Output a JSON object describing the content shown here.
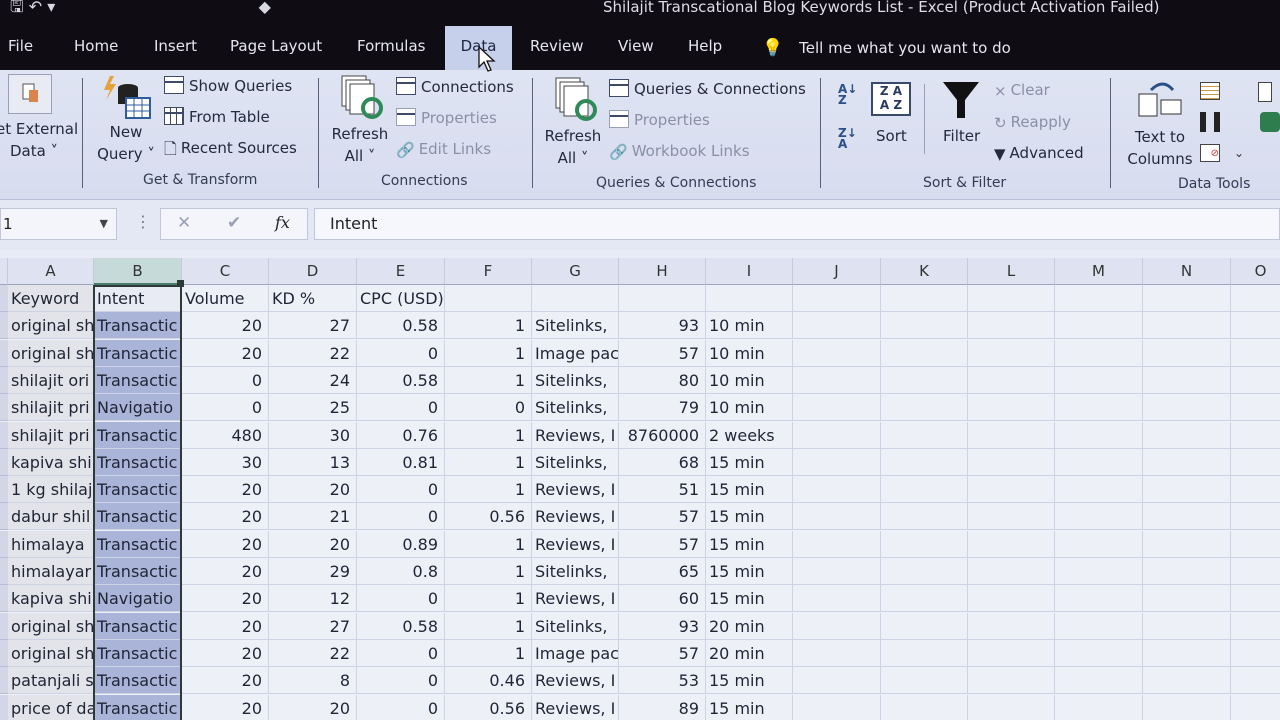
{
  "window": {
    "title": "Shilajit Transcational Blog Keywords List  -  Excel (Product Activation Failed)"
  },
  "tabs": [
    {
      "label": "File",
      "active": false
    },
    {
      "label": "Home",
      "active": false
    },
    {
      "label": "Insert",
      "active": false
    },
    {
      "label": "Page Layout",
      "active": false
    },
    {
      "label": "Formulas",
      "active": false
    },
    {
      "label": "Data",
      "active": true
    },
    {
      "label": "Review",
      "active": false
    },
    {
      "label": "View",
      "active": false
    },
    {
      "label": "Help",
      "active": false
    }
  ],
  "tell_me": {
    "placeholder": "Tell me what you want to do",
    "icon": "lightbulb-icon"
  },
  "ribbon": {
    "get_external_data": {
      "line1": "et External",
      "line2": "Data ˅"
    },
    "get_transform": {
      "label": "Get & Transform",
      "new_query": {
        "line1": "New",
        "line2": "Query ˅"
      },
      "show_queries": "Show Queries",
      "from_table": "From Table",
      "recent_sources": "Recent Sources"
    },
    "connections": {
      "label": "Connections",
      "refresh_all": {
        "line1": "Refresh",
        "line2": "All ˅"
      },
      "connections": "Connections",
      "properties": "Properties",
      "edit_links": "Edit Links"
    },
    "queries_connections": {
      "label": "Queries & Connections",
      "refresh_all": {
        "line1": "Refresh",
        "line2": "All ˅"
      },
      "queries_connections": "Queries & Connections",
      "properties": "Properties",
      "workbook_links": "Workbook Links"
    },
    "sort_filter": {
      "label": "Sort & Filter",
      "sort_az": "A↓Z",
      "sort_za": "Z↓A",
      "sort": "Sort",
      "filter": "Filter",
      "clear": "Clear",
      "reapply": "Reapply",
      "advanced": "Advanced"
    },
    "data_tools": {
      "label": "Data Tools",
      "text_to_columns": {
        "line1": "Text to",
        "line2": "Columns"
      }
    }
  },
  "formula_bar": {
    "name_box": "1",
    "cancel": "✕",
    "enter": "✔",
    "fx": "fx",
    "content": "Intent"
  },
  "columns": [
    "A",
    "B",
    "C",
    "D",
    "E",
    "F",
    "G",
    "H",
    "I",
    "J",
    "K",
    "L",
    "M",
    "N",
    "O"
  ],
  "selected_column": "B",
  "header_row": [
    "Keyword",
    "Intent",
    "Volume",
    "KD %",
    "CPC (USD)",
    "",
    "",
    "",
    ""
  ],
  "rows": [
    [
      "original sh",
      "Transactic",
      "20",
      "27",
      "0.58",
      "1",
      "Sitelinks,",
      "93",
      "10 min"
    ],
    [
      "original sh",
      "Transactic",
      "20",
      "22",
      "0",
      "1",
      "Image pac",
      "57",
      "10 min"
    ],
    [
      "shilajit ori",
      "Transactic",
      "0",
      "24",
      "0.58",
      "1",
      "Sitelinks,",
      "80",
      "10 min"
    ],
    [
      "shilajit pri",
      "Navigatio",
      "0",
      "25",
      "0",
      "0",
      "Sitelinks,",
      "79",
      "10 min"
    ],
    [
      "shilajit pri",
      "Transactic",
      "480",
      "30",
      "0.76",
      "1",
      "Reviews, I",
      "8760000",
      "2 weeks"
    ],
    [
      "kapiva shi",
      "Transactic",
      "30",
      "13",
      "0.81",
      "1",
      "Sitelinks,",
      "68",
      "15 min"
    ],
    [
      "1 kg shilaj",
      "Transactic",
      "20",
      "20",
      "0",
      "1",
      "Reviews, I",
      "51",
      "15 min"
    ],
    [
      "dabur shil",
      "Transactic",
      "20",
      "21",
      "0",
      "0.56",
      "Reviews, I",
      "57",
      "15 min"
    ],
    [
      "himalaya",
      "Transactic",
      "20",
      "20",
      "0.89",
      "1",
      "Reviews, I",
      "57",
      "15 min"
    ],
    [
      "himalayar",
      "Transactic",
      "20",
      "29",
      "0.8",
      "1",
      "Sitelinks,",
      "65",
      "15 min"
    ],
    [
      "kapiva shi",
      "Navigatio",
      "20",
      "12",
      "0",
      "1",
      "Reviews, I",
      "60",
      "15 min"
    ],
    [
      "original sh",
      "Transactic",
      "20",
      "27",
      "0.58",
      "1",
      "Sitelinks,",
      "93",
      "20 min"
    ],
    [
      "original sh",
      "Transactic",
      "20",
      "22",
      "0",
      "1",
      "Image pac",
      "57",
      "20 min"
    ],
    [
      "patanjali s",
      "Transactic",
      "20",
      "8",
      "0",
      "0.46",
      "Reviews, I",
      "53",
      "15 min"
    ],
    [
      "price of da",
      "Transactic",
      "20",
      "20",
      "0",
      "0.56",
      "Reviews, I",
      "89",
      "15 min"
    ]
  ]
}
